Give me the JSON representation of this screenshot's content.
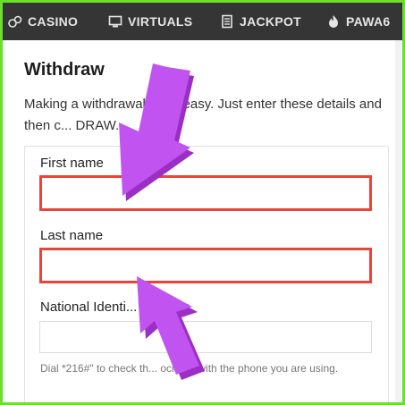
{
  "nav": {
    "items": [
      {
        "label": "CASINO",
        "icon": "dice-icon"
      },
      {
        "label": "VIRTUALS",
        "icon": "monitor-icon"
      },
      {
        "label": "JACKPOT",
        "icon": "list-icon"
      },
      {
        "label": "PAWA6",
        "icon": "flame-icon"
      }
    ]
  },
  "withdraw": {
    "title": "Withdraw",
    "intro": "Making a withdrawal ... nd easy. Just enter these details and then c... DRAW.",
    "first_name_label": "First name",
    "first_name_value": "",
    "last_name_label": "Last name",
    "last_name_value": "",
    "nin_label": "National Identi... Number",
    "nin_value": "",
    "hint": "Dial *216#\" to check th... ociated with the phone you are using."
  },
  "colors": {
    "nav_bg": "#353535",
    "frame_border": "#69e02a",
    "highlight_border": "#e8443a",
    "arrow_fill": "#c154f0"
  }
}
